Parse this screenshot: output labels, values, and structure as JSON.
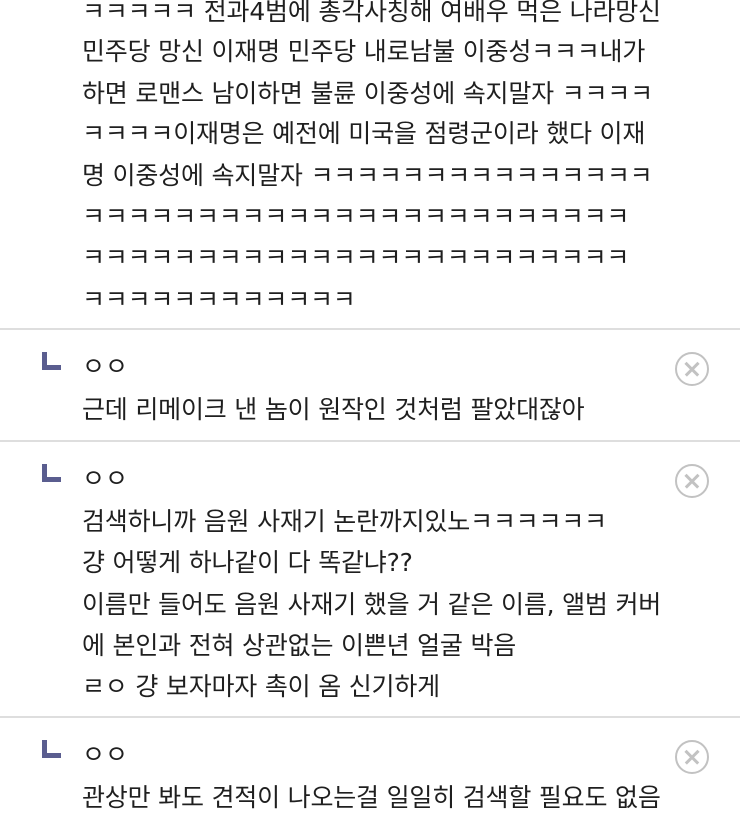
{
  "main_comment": {
    "lines": [
      "ㅋㅋㅋㅋㅋ 전과4범에 총각사칭해 여배우 먹은 나라망신",
      "민주당 망신 이재명 민주당 내로남불 이중성ㅋㅋㅋ내가",
      "하면 로맨스 남이하면 불륜 이중성에 속지말자 ㅋㅋㅋㅋ",
      "ㅋㅋㅋㅋ이재명은 예전에 미국을 점령군이라 했다 이재",
      "명 이중성에 속지말자 ㅋㅋㅋㅋㅋㅋㅋㅋㅋㅋㅋㅋㅋㅋㅋ",
      "ㅋㅋㅋㅋㅋㅋㅋㅋㅋㅋㅋㅋㅋㅋㅋㅋㅋㅋㅋㅋㅋㅋㅋㅋ",
      "ㅋㅋㅋㅋㅋㅋㅋㅋㅋㅋㅋㅋㅋㅋㅋㅋㅋㅋㅋㅋㅋㅋㅋㅋ",
      "ㅋㅋㅋㅋㅋㅋㅋㅋㅋㅋㅋㅋ"
    ]
  },
  "replies": [
    {
      "author": "ㅇㅇ",
      "lines": [
        "근데 리메이크 낸 놈이 원작인 것처럼 팔았대잖아"
      ],
      "delete_icon": "circle-x-icon"
    },
    {
      "author": "ㅇㅇ",
      "lines": [
        "검색하니까 음원 사재기 논란까지있노ㅋㅋㅋㅋㅋㅋ",
        "걍 어떻게 하나같이 다 똑같냐??",
        "이름만 들어도 음원 사재기 했을 거 같은 이름, 앨범 커버",
        "에 본인과 전혀 상관없는 이쁜년 얼굴 박음",
        "ㄹㅇ 걍 보자마자 촉이 옴 신기하게"
      ],
      "delete_icon": "circle-x-icon"
    },
    {
      "author": "ㅇㅇ",
      "lines": [
        "관상만 봐도 견적이 나오는걸 일일히 검색할 필요도 없음"
      ],
      "delete_icon": "circle-x-icon"
    }
  ],
  "colors": {
    "reply_marker": "#5a5d8f",
    "divider": "#dedede",
    "delete_icon": "#c2c2c2",
    "text": "#1f1f1f"
  }
}
